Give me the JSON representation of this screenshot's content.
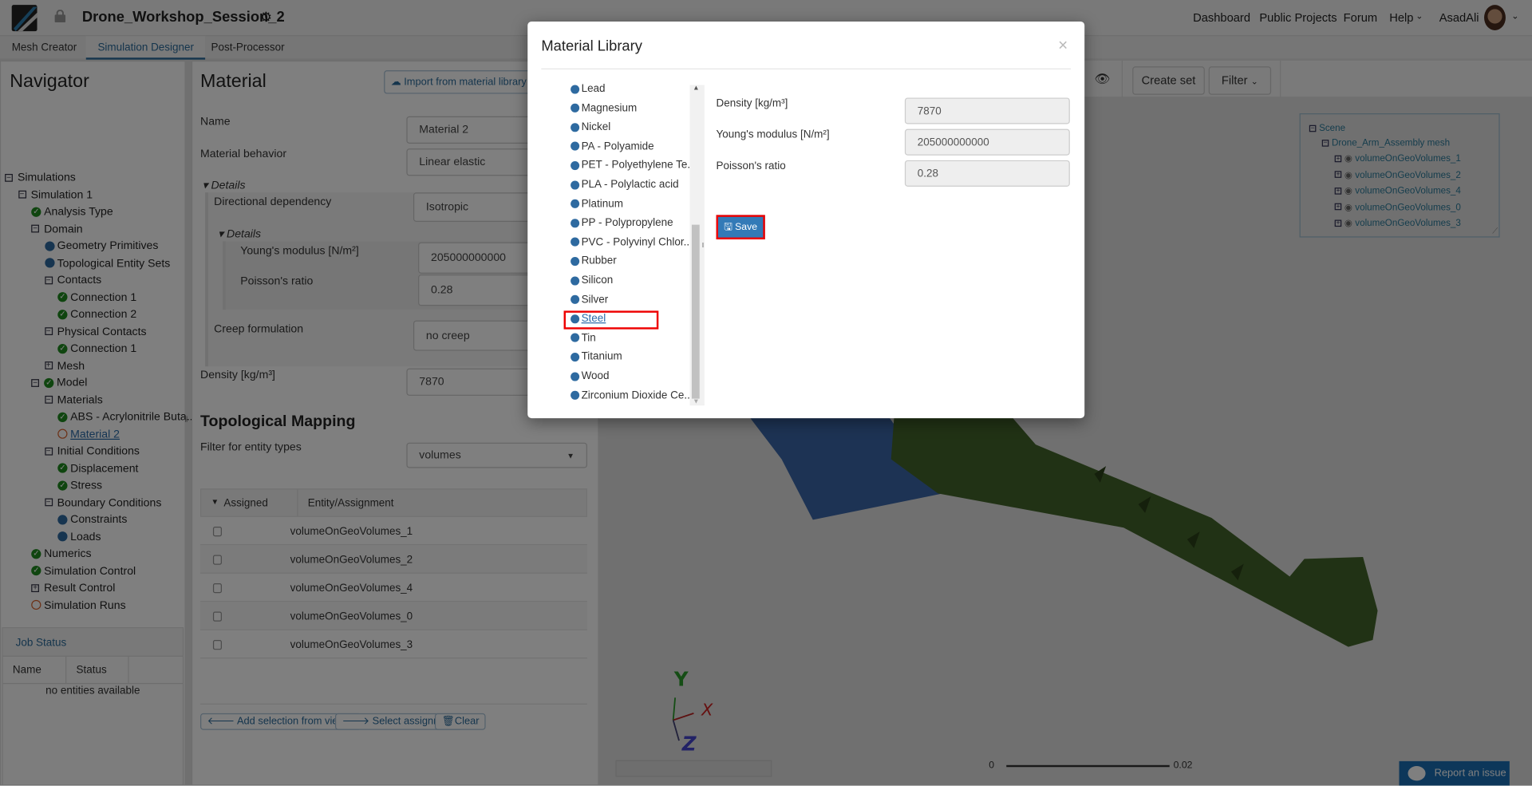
{
  "topbar": {
    "project_title": "Drone_Workshop_Session_2",
    "nav": [
      "Dashboard",
      "Public Projects",
      "Forum",
      "Help"
    ],
    "user": "AsadAli"
  },
  "tabs": [
    "Mesh Creator",
    "Simulation Designer",
    "Post-Processor"
  ],
  "navigator": {
    "title": "Navigator",
    "tree": [
      {
        "label": "Simulations",
        "level": 0,
        "icon": "minus"
      },
      {
        "label": "Simulation 1",
        "level": 1,
        "icon": "minus"
      },
      {
        "label": "Analysis Type",
        "level": 2,
        "icon": "check"
      },
      {
        "label": "Domain",
        "level": 2,
        "icon": "minus"
      },
      {
        "label": "Geometry Primitives",
        "level": 3,
        "icon": "dot"
      },
      {
        "label": "Topological Entity Sets",
        "level": 3,
        "icon": "dot"
      },
      {
        "label": "Contacts",
        "level": 3,
        "icon": "minus"
      },
      {
        "label": "Connection 1",
        "level": 4,
        "icon": "check"
      },
      {
        "label": "Connection 2",
        "level": 4,
        "icon": "check"
      },
      {
        "label": "Physical Contacts",
        "level": 3,
        "icon": "minus"
      },
      {
        "label": "Connection 1",
        "level": 4,
        "icon": "check"
      },
      {
        "label": "Mesh",
        "level": 3,
        "icon": "plus"
      },
      {
        "label": "Model",
        "level": 2,
        "icon": "minus-check"
      },
      {
        "label": "Materials",
        "level": 3,
        "icon": "minus"
      },
      {
        "label": "ABS - Acrylonitrile Buta...",
        "level": 4,
        "icon": "check"
      },
      {
        "label": "Material 2",
        "level": 4,
        "icon": "open",
        "active": true
      },
      {
        "label": "Initial Conditions",
        "level": 3,
        "icon": "minus"
      },
      {
        "label": "Displacement",
        "level": 4,
        "icon": "check"
      },
      {
        "label": "Stress",
        "level": 4,
        "icon": "check"
      },
      {
        "label": "Boundary Conditions",
        "level": 3,
        "icon": "minus"
      },
      {
        "label": "Constraints",
        "level": 4,
        "icon": "dot"
      },
      {
        "label": "Loads",
        "level": 4,
        "icon": "dot"
      },
      {
        "label": "Numerics",
        "level": 2,
        "icon": "check"
      },
      {
        "label": "Simulation Control",
        "level": 2,
        "icon": "check"
      },
      {
        "label": "Result Control",
        "level": 2,
        "icon": "plus"
      },
      {
        "label": "Simulation Runs",
        "level": 2,
        "icon": "open"
      }
    ]
  },
  "job_status": {
    "title": "Job Status",
    "columns": [
      "Name",
      "Status"
    ],
    "empty": "no entities available"
  },
  "material": {
    "title": "Material",
    "import_label": "Import from material library",
    "name_label": "Name",
    "name_value": "Material 2",
    "behavior_label": "Material behavior",
    "behavior_value": "Linear elastic",
    "details_label": "Details",
    "dir_label": "Directional dependency",
    "dir_value": "Isotropic",
    "inner_details_label": "Details",
    "youngs_label": "Young's modulus [N/m²]",
    "youngs_value": "205000000000",
    "poisson_label": "Poisson's ratio",
    "poisson_value": "0.28",
    "creep_label": "Creep formulation",
    "creep_value": "no creep",
    "density_label": "Density [kg/m³]",
    "density_value": "7870"
  },
  "topo": {
    "title": "Topological Mapping",
    "filter_label": "Filter for entity types",
    "filter_value": "volumes",
    "columns": [
      "Assigned",
      "Entity/Assignment"
    ],
    "rows": [
      "volumeOnGeoVolumes_1",
      "volumeOnGeoVolumes_2",
      "volumeOnGeoVolumes_4",
      "volumeOnGeoVolumes_0",
      "volumeOnGeoVolumes_3"
    ],
    "buttons": {
      "add": "Add selection from viewer",
      "select": "Select assignment",
      "clear": "Clear"
    }
  },
  "viewer": {
    "create_set": "Create set",
    "filter": "Filter",
    "scene_tree": {
      "root": "Scene",
      "mesh": "Drone_Arm_Assembly mesh",
      "volumes": [
        "volumeOnGeoVolumes_1",
        "volumeOnGeoVolumes_2",
        "volumeOnGeoVolumes_4",
        "volumeOnGeoVolumes_0",
        "volumeOnGeoVolumes_3"
      ]
    },
    "axes": {
      "x": "X",
      "y": "Y",
      "z": "Z"
    },
    "scale": {
      "min": "0",
      "max": "0.02"
    },
    "report": "Report an issue",
    "colors": {
      "part_blue": "#3b66a8",
      "part_green": "#43652a"
    }
  },
  "modal": {
    "title": "Material Library",
    "close": "×",
    "materials": [
      "Lead",
      "Magnesium",
      "Nickel",
      "PA - Polyamide",
      "PET - Polyethylene Te...",
      "PLA - Polylactic acid",
      "Platinum",
      "PP - Polypropylene",
      "PVC - Polyvinyl Chlor...",
      "Rubber",
      "Silicon",
      "Silver",
      "Steel",
      "Tin",
      "Titanium",
      "Wood",
      "Zirconium Dioxide Ce..."
    ],
    "selected": "Steel",
    "fields": [
      {
        "label": "Density [kg/m³]",
        "value": "7870"
      },
      {
        "label": "Young's modulus [N/m²]",
        "value": "205000000000"
      },
      {
        "label": "Poisson's ratio",
        "value": "0.28"
      }
    ],
    "save": "Save"
  }
}
